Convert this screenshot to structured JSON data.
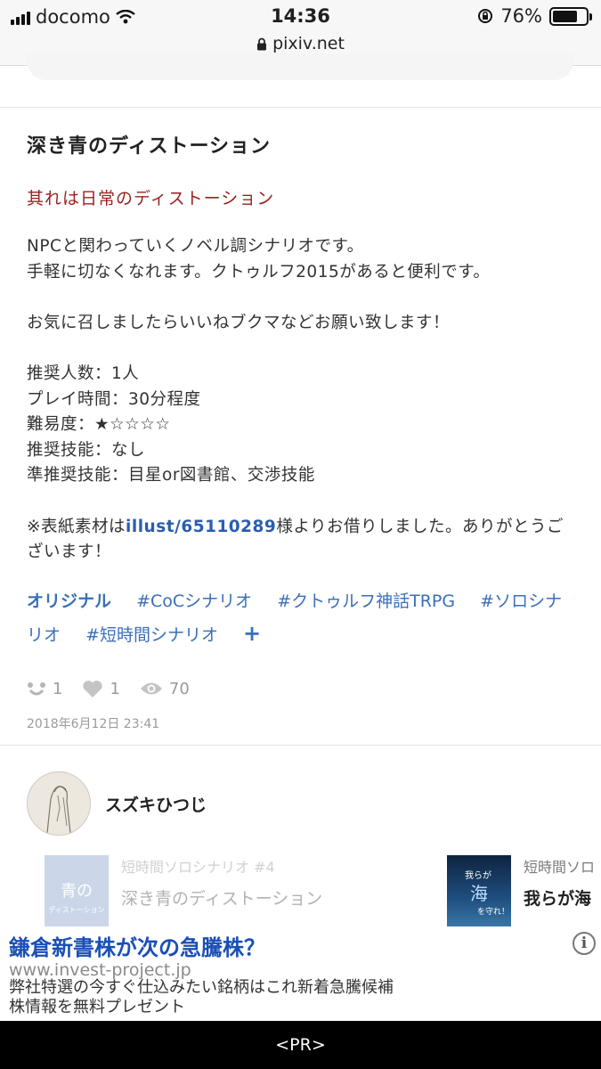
{
  "status_bar": {
    "carrier": "docomo",
    "time": "14:36",
    "battery": "76%",
    "battery_level": 0.76
  },
  "browser": {
    "domain": "pixiv.net"
  },
  "novel": {
    "title": "深き青のディストーション",
    "subtitle": "其れは日常のディストーション",
    "desc_lines": [
      "NPCと関わっていくノベル調シナリオです。",
      "手軽に切なくなれます。クトゥルフ2015があると便利です。",
      "",
      "お気に召しましたらいいねブクマなどお願い致します！",
      "",
      "推奨人数：1人",
      "プレイ時間：30分程度",
      "難易度：★☆☆☆☆",
      "推奨技能：なし",
      "準推奨技能：目星or図書館、交渉技能"
    ],
    "credit_prefix": "※表紙素材は",
    "credit_link": "illust/65110289",
    "credit_suffix": "様よりお借りしました。ありがとうございます！",
    "tags": [
      "オリジナル",
      "#CoCシナリオ",
      "#クトゥルフ神話TRPG",
      "#ソロシナリオ",
      "#短時間シナリオ"
    ],
    "add_tag": "+",
    "stats": {
      "bookmarks": "1",
      "likes": "1",
      "views": "70"
    },
    "date": "2018年6月12日 23:41"
  },
  "author": {
    "name": "スズキひつじ"
  },
  "related": [
    {
      "series": "短時間ソロシナリオ #4",
      "title": "深き青のディストーション",
      "thumb_text": "深き青のディストーション"
    },
    {
      "series": "短時間ソロ",
      "title": "我らが海",
      "thumb_text": "我らが海を守れ！"
    }
  ],
  "ad": {
    "headline": "鎌倉新書株が次の急騰株？",
    "url": "www.invest-project.jp",
    "body_line1": "弊社特選の今すぐ仕込みたい銘柄はこれ新着急騰候補",
    "body_line2": "株情報を無料プレゼント",
    "info": "i"
  },
  "bottom_bar": {
    "label": "<PR>"
  }
}
